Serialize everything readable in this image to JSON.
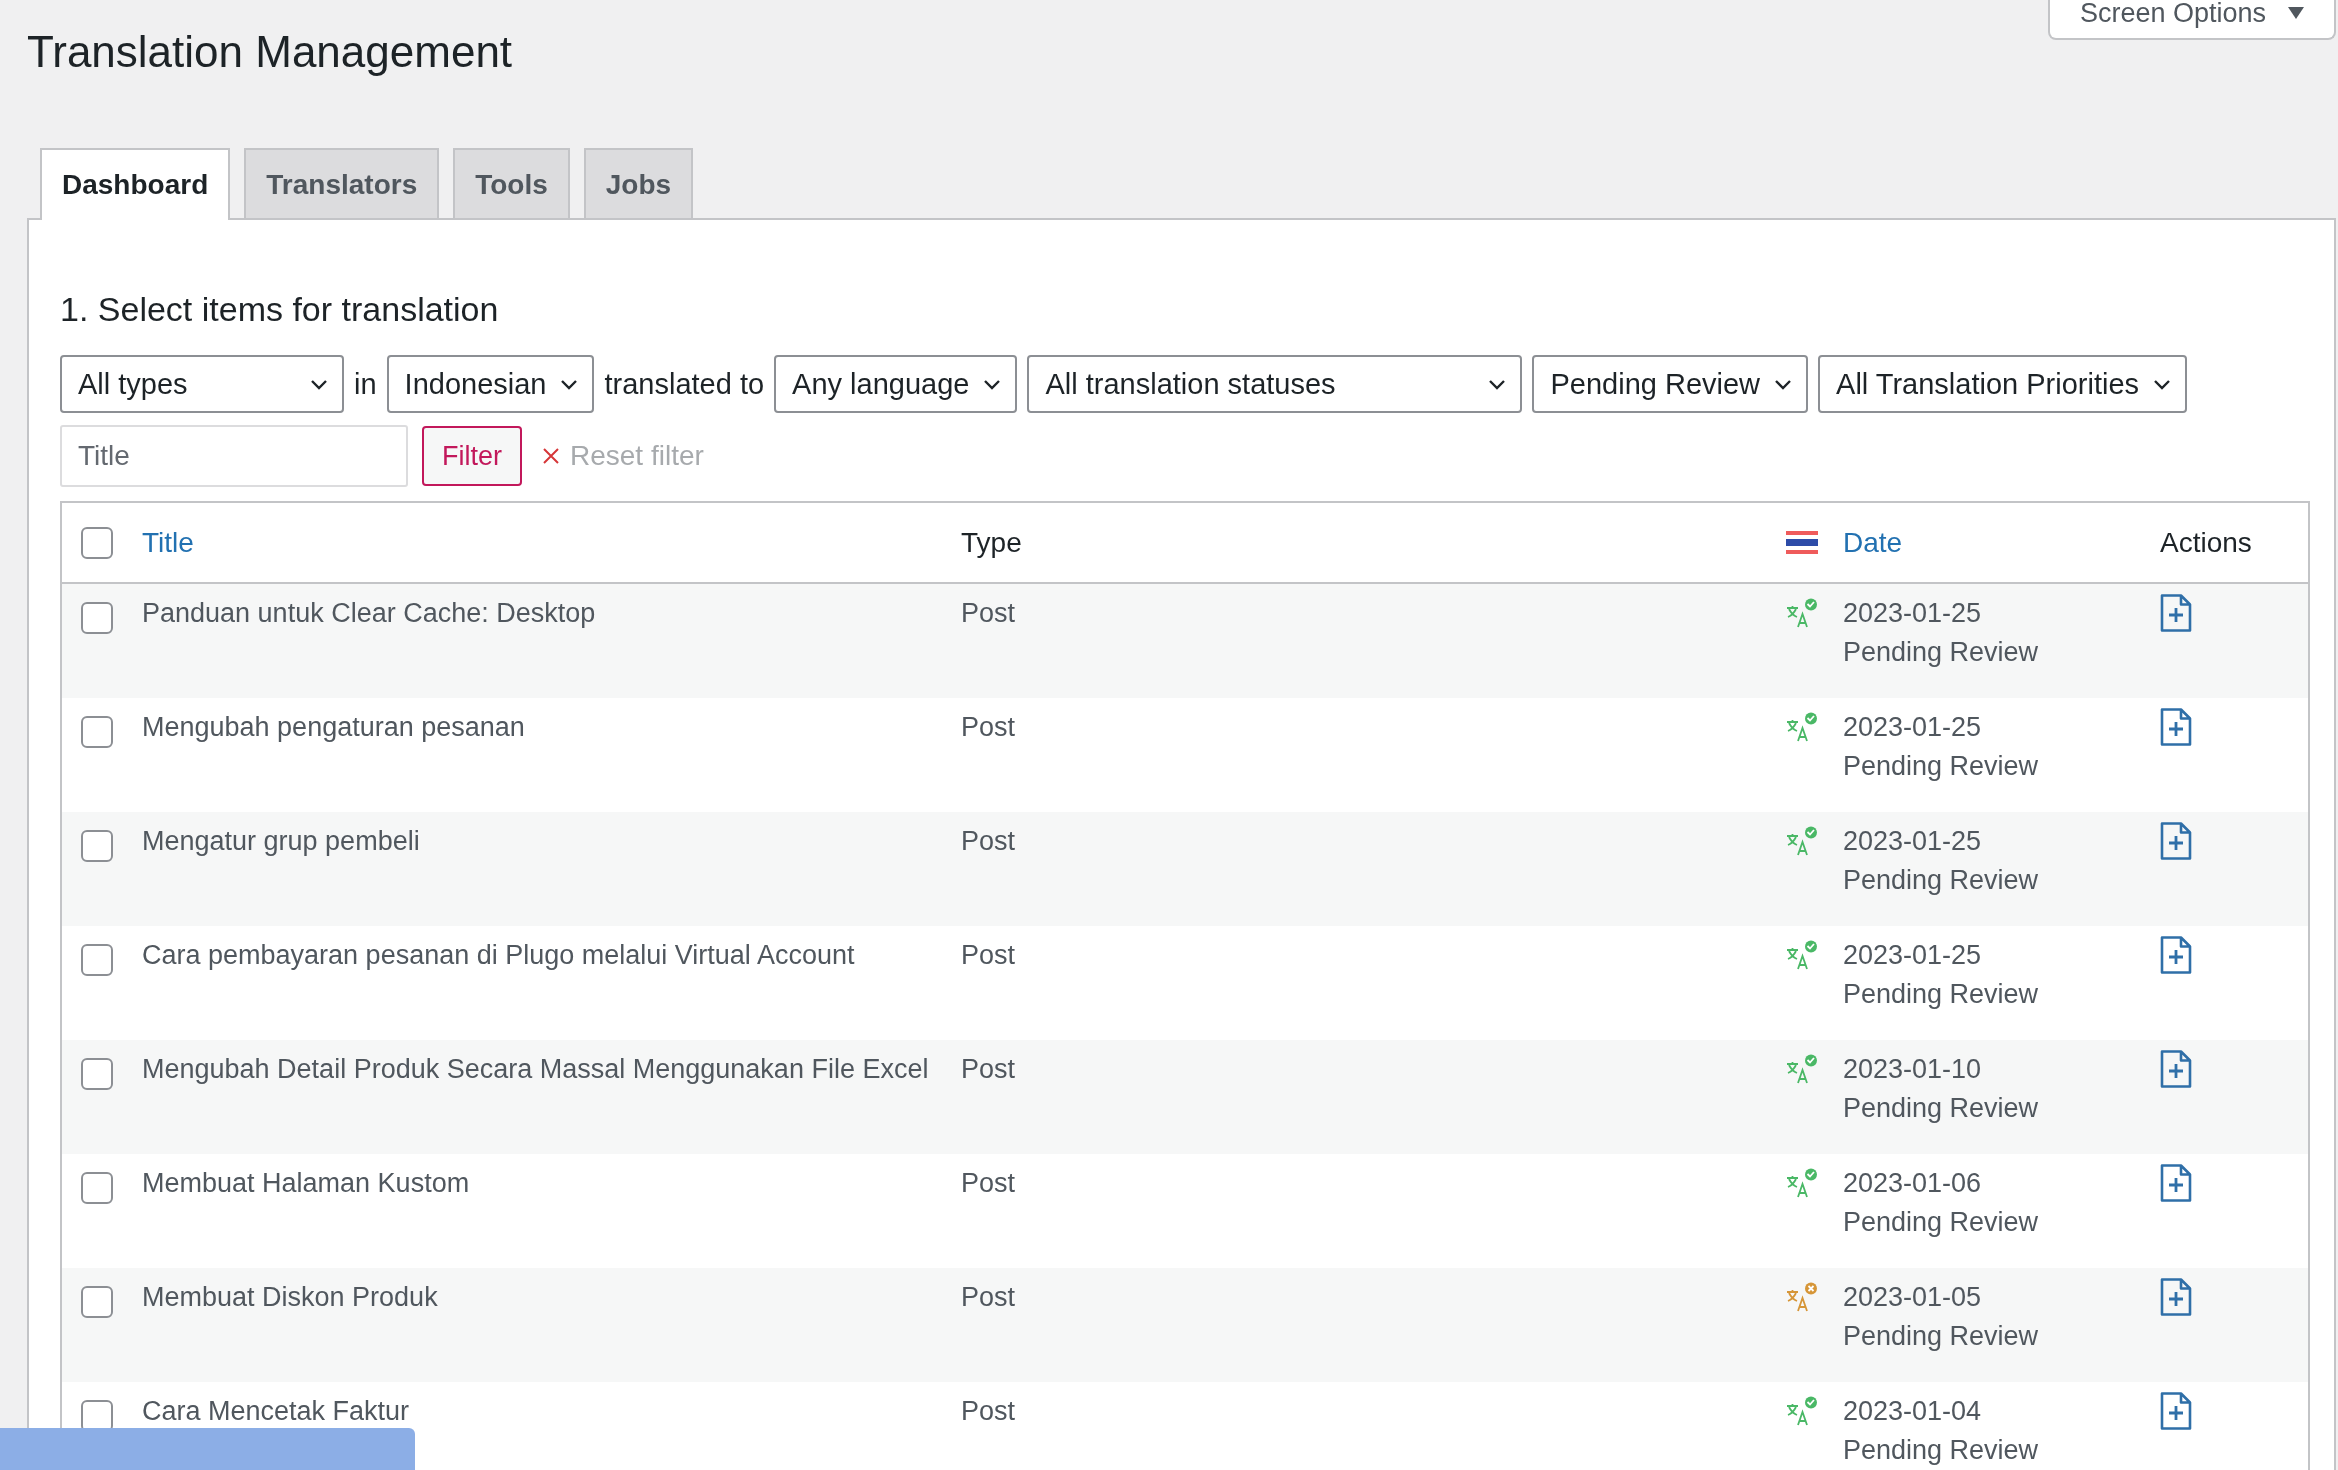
{
  "page": {
    "title": "Translation Management"
  },
  "screen_options": {
    "label": "Screen Options"
  },
  "tabs": [
    {
      "label": "Dashboard",
      "selected": true
    },
    {
      "label": "Translators",
      "selected": false
    },
    {
      "label": "Tools",
      "selected": false
    },
    {
      "label": "Jobs",
      "selected": false
    }
  ],
  "section": {
    "heading": "1. Select items for translation"
  },
  "filters": [
    {
      "kind": "select",
      "value": "All types"
    },
    {
      "kind": "text",
      "text": "in"
    },
    {
      "kind": "select",
      "value": "Indonesian"
    },
    {
      "kind": "text",
      "text": "translated to"
    },
    {
      "kind": "select",
      "value": "Any language"
    },
    {
      "kind": "select",
      "value": "All translation statuses"
    },
    {
      "kind": "select",
      "value": "Pending Review"
    },
    {
      "kind": "select",
      "value": "All Translation Priorities"
    }
  ],
  "search": {
    "placeholder": "Title"
  },
  "filter_button": "Filter",
  "reset_filter": "Reset filter",
  "table": {
    "select_all_checked": false,
    "columns": [
      {
        "label": "Title",
        "link": true
      },
      {
        "label": "Type",
        "link": false
      },
      {
        "kind": "flag"
      },
      {
        "label": "Date",
        "link": true
      },
      {
        "label": "Actions",
        "link": false
      }
    ],
    "rows": [
      {
        "checked": false,
        "title": "Panduan untuk Clear Cache: Desktop",
        "type": "Post",
        "kind": "done",
        "date": "2023-01-25",
        "status": "Pending Review"
      },
      {
        "checked": false,
        "title": "Mengubah pengaturan pesanan",
        "type": "Post",
        "kind": "done",
        "date": "2023-01-25",
        "status": "Pending Review"
      },
      {
        "checked": false,
        "title": "Mengatur grup pembeli",
        "type": "Post",
        "kind": "done",
        "date": "2023-01-25",
        "status": "Pending Review"
      },
      {
        "checked": false,
        "title": "Cara pembayaran pesanan di Plugo melalui Virtual Account",
        "type": "Post",
        "kind": "done",
        "date": "2023-01-25",
        "status": "Pending Review"
      },
      {
        "checked": false,
        "title": "Mengubah Detail Produk Secara Massal Menggunakan File Excel",
        "type": "Post",
        "kind": "done",
        "date": "2023-01-10",
        "status": "Pending Review"
      },
      {
        "checked": false,
        "title": "Membuat Halaman Kustom",
        "type": "Post",
        "kind": "done",
        "date": "2023-01-06",
        "status": "Pending Review"
      },
      {
        "checked": false,
        "title": "Membuat Diskon Produk",
        "type": "Post",
        "kind": "error",
        "date": "2023-01-05",
        "status": "Pending Review"
      },
      {
        "checked": false,
        "title": "Cara Mencetak Faktur",
        "type": "Post",
        "kind": "done",
        "date": "2023-01-04",
        "status": "Pending Review"
      }
    ]
  }
}
